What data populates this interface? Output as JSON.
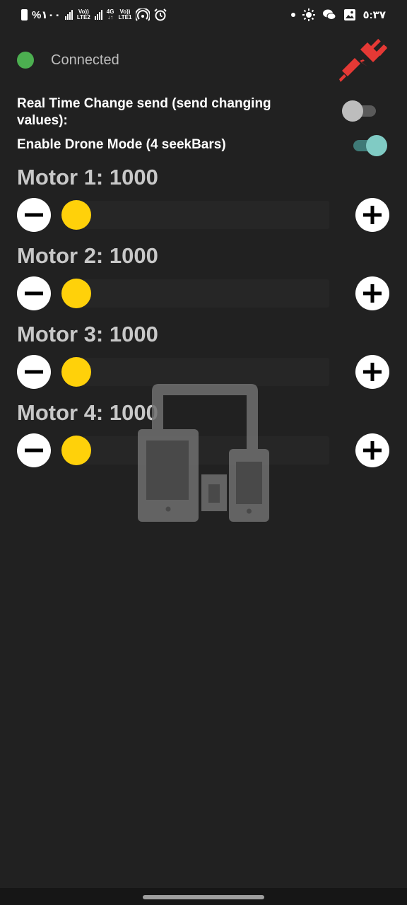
{
  "status_bar": {
    "battery_percent": "%١٠٠",
    "sim2_label_top": "Vo))",
    "sim2_label_bottom": "LTE2",
    "network_type": "4G",
    "sim1_label_top": "Vo))",
    "sim1_label_bottom": "LTE1",
    "time": "٥:٣٧"
  },
  "connection": {
    "status_label": "Connected",
    "status_color": "#4caf50",
    "disconnect_icon_color": "#e53935"
  },
  "settings": {
    "realtime_label": "Real Time Change send (send changing values):",
    "realtime_enabled": false,
    "drone_mode_label": "Enable Drone Mode (4 seekBars)",
    "drone_mode_enabled": true
  },
  "motors": [
    {
      "title": "Motor 1: 1000",
      "value": 1000
    },
    {
      "title": "Motor 2: 1000",
      "value": 1000
    },
    {
      "title": "Motor 3: 1000",
      "value": 1000
    },
    {
      "title": "Motor 4: 1000",
      "value": 1000
    }
  ],
  "colors": {
    "background": "#212121",
    "seek_thumb": "#ffd10a",
    "switch_on": "#80cbc4"
  }
}
